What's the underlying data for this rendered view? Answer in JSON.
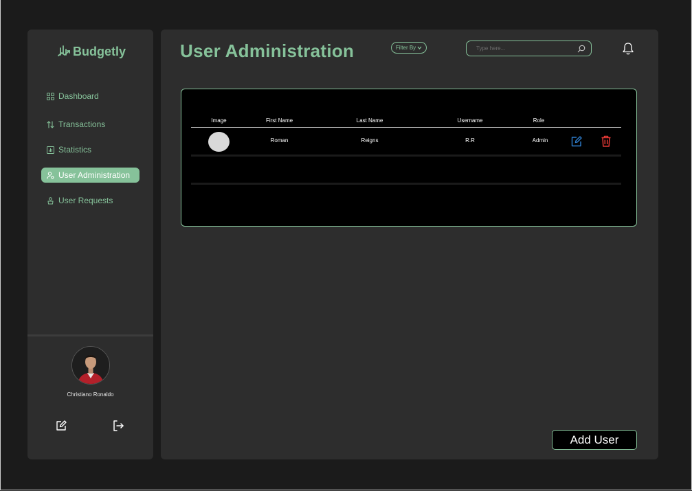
{
  "brand": {
    "name": "Budgetly",
    "color": "#86c29a"
  },
  "sidebar": {
    "items": [
      {
        "label": "Dashboard",
        "icon": "grid-icon",
        "active": false
      },
      {
        "label": "Transactions",
        "icon": "arrows-updown-icon",
        "active": false
      },
      {
        "label": "Statistics",
        "icon": "bar-chart-icon",
        "active": false
      },
      {
        "label": "User Administration",
        "icon": "user-gear-icon",
        "active": true
      },
      {
        "label": "User Requests",
        "icon": "user-request-icon",
        "active": false
      }
    ],
    "profile": {
      "name": "Christiano Ronaldo"
    },
    "footer": {
      "edit_icon": "edit-icon",
      "logout_icon": "logout-icon"
    }
  },
  "header": {
    "title": "User Administration",
    "filter_label": "Filter By",
    "search_placeholder": "Type here...",
    "bell_icon": "bell-icon"
  },
  "table": {
    "columns": [
      "Image",
      "First Name",
      "Last Name",
      "Username",
      "Role"
    ],
    "rows": [
      {
        "first_name": "Roman",
        "last_name": "Reigns",
        "username": "R.R",
        "role": "Admin"
      }
    ]
  },
  "add_user_label": "Add User",
  "colors": {
    "accent": "#86c29a",
    "edit": "#2f7fd0",
    "delete": "#e53935",
    "panel": "#2d2d2d",
    "background": "#1b1b1b"
  }
}
